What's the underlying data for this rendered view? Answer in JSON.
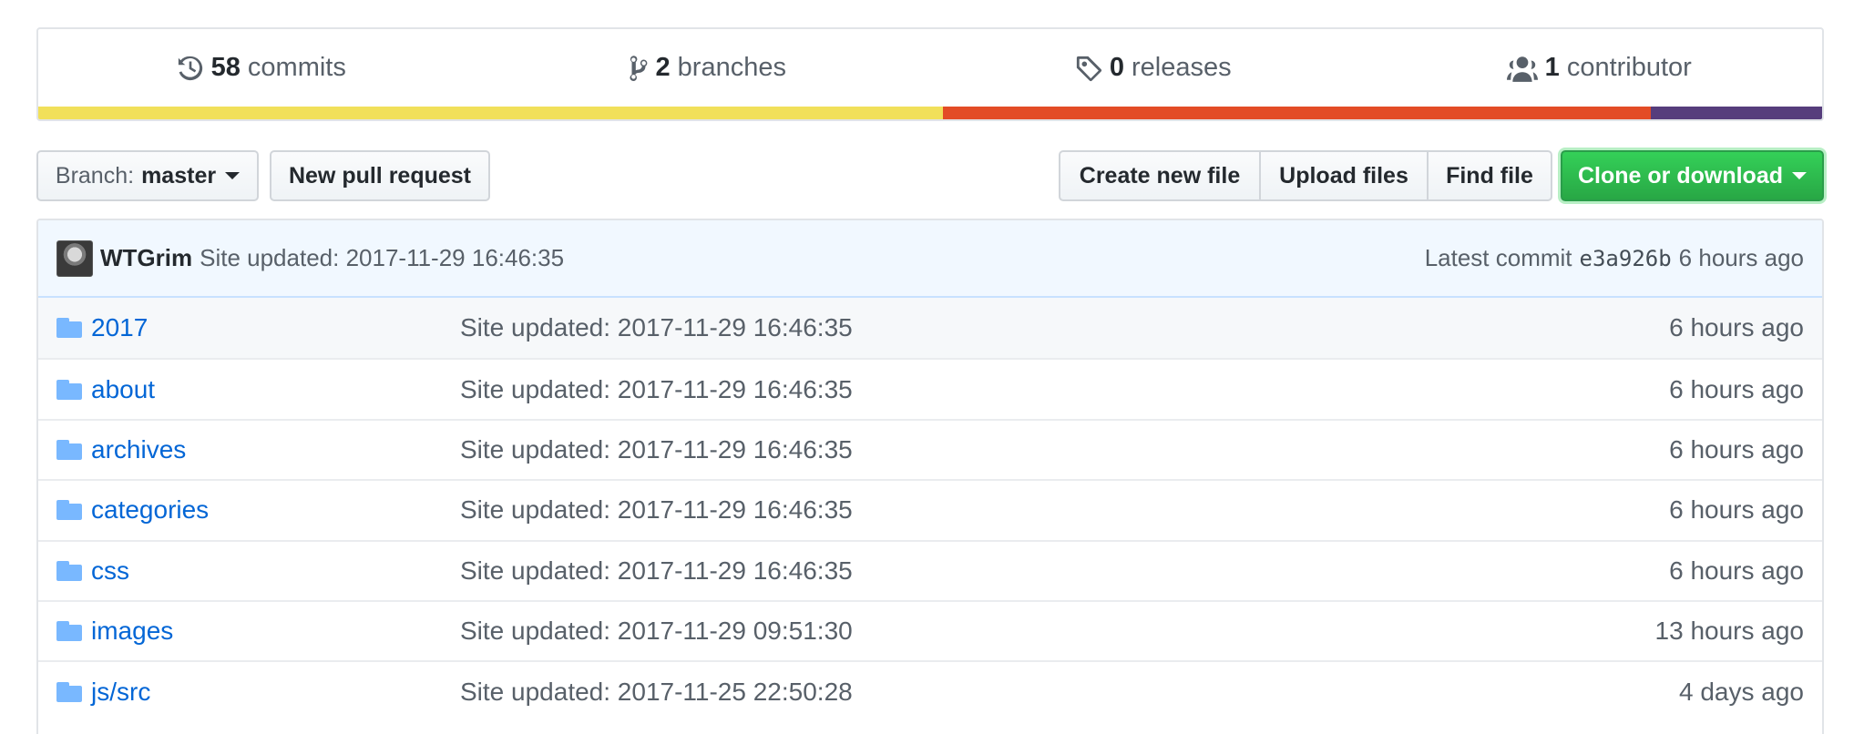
{
  "summary": {
    "commits": {
      "count": "58",
      "label": "commits"
    },
    "branches": {
      "count": "2",
      "label": "branches"
    },
    "releases": {
      "count": "0",
      "label": "releases"
    },
    "contributors": {
      "count": "1",
      "label": "contributor"
    },
    "languages": [
      {
        "color": "#f1e05a",
        "percent": 50.7
      },
      {
        "color": "#e34c26",
        "percent": 39.7
      },
      {
        "color": "#563d7c",
        "percent": 9.6
      }
    ]
  },
  "toolbar": {
    "branch_prefix": "Branch:",
    "branch_name": "master",
    "new_pull_request": "New pull request",
    "create_new_file": "Create new file",
    "upload_files": "Upload files",
    "find_file": "Find file",
    "clone_or_download": "Clone or download"
  },
  "latest_commit": {
    "author": "WTGrim",
    "message": "Site updated: 2017-11-29 16:46:35",
    "label": "Latest commit",
    "sha": "e3a926b",
    "age": "6 hours ago"
  },
  "files": [
    {
      "name": "2017",
      "message": "Site updated: 2017-11-29 16:46:35",
      "age": "6 hours ago"
    },
    {
      "name": "about",
      "message": "Site updated: 2017-11-29 16:46:35",
      "age": "6 hours ago"
    },
    {
      "name": "archives",
      "message": "Site updated: 2017-11-29 16:46:35",
      "age": "6 hours ago"
    },
    {
      "name": "categories",
      "message": "Site updated: 2017-11-29 16:46:35",
      "age": "6 hours ago"
    },
    {
      "name": "css",
      "message": "Site updated: 2017-11-29 16:46:35",
      "age": "6 hours ago"
    },
    {
      "name": "images",
      "message": "Site updated: 2017-11-29 09:51:30",
      "age": "13 hours ago"
    },
    {
      "name": "js/src",
      "message": "Site updated: 2017-11-25 22:50:28",
      "age": "4 days ago"
    }
  ]
}
